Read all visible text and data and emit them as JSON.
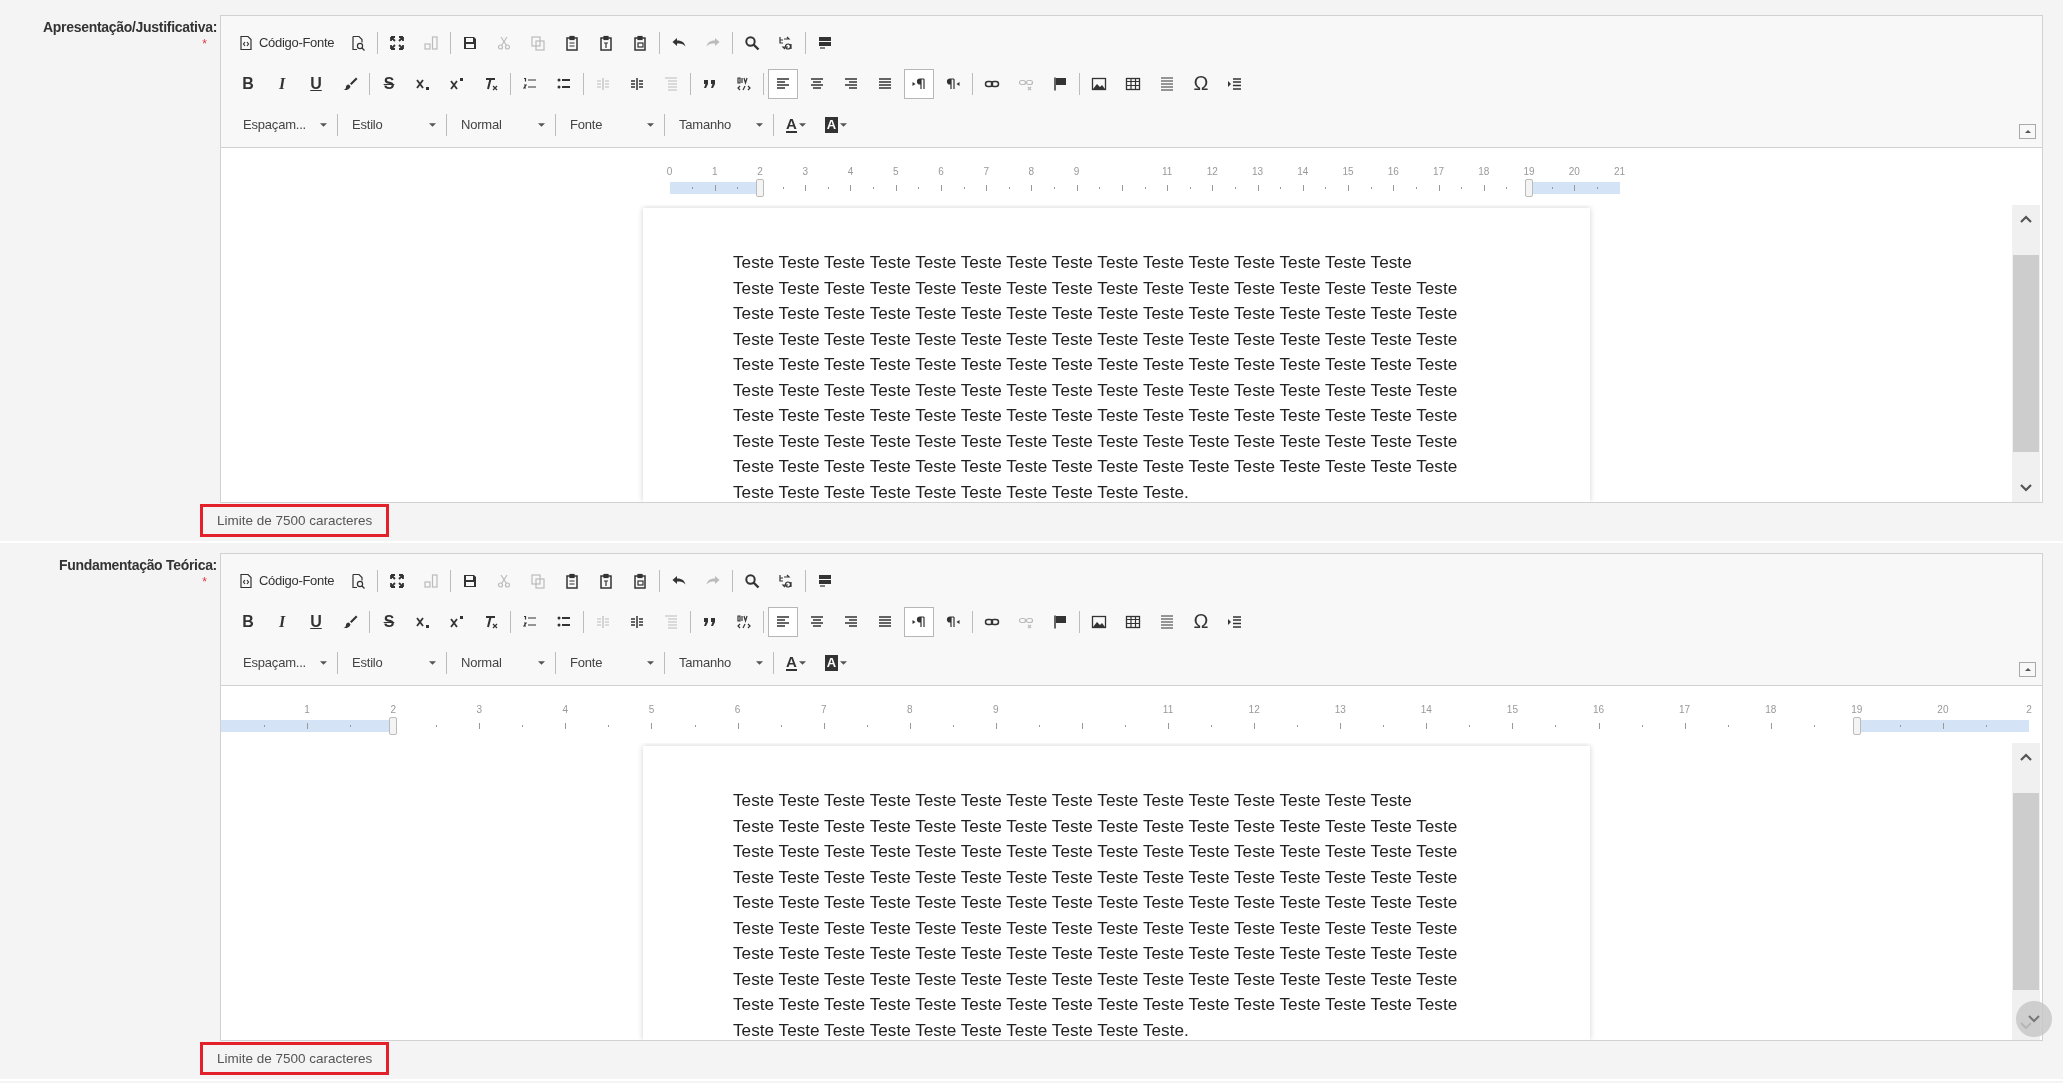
{
  "sections": [
    {
      "label": "Apresentação/Justificativa:",
      "required_mark": "*",
      "editor": {
        "toolbar": [
          [
            [
              {
                "kind": "label-button",
                "label": "Código-Fonte",
                "disabled": false,
                "selected": false
              },
              {
                "kind": "button",
                "disabled": false,
                "selected": false
              }
            ],
            [
              {
                "kind": "button",
                "disabled": false,
                "selected": false
              },
              {
                "kind": "button",
                "disabled": true,
                "selected": false
              }
            ],
            [
              {
                "kind": "button",
                "disabled": false,
                "selected": false
              },
              {
                "kind": "button",
                "disabled": true,
                "selected": false
              },
              {
                "kind": "button",
                "disabled": true,
                "selected": false
              },
              {
                "kind": "button",
                "disabled": false,
                "selected": false
              },
              {
                "kind": "button",
                "disabled": false,
                "selected": false
              },
              {
                "kind": "button",
                "disabled": false,
                "selected": false
              }
            ],
            [
              {
                "kind": "button",
                "disabled": false,
                "selected": false
              },
              {
                "kind": "button",
                "disabled": true,
                "selected": false
              }
            ],
            [
              {
                "kind": "button",
                "disabled": false,
                "selected": false
              },
              {
                "kind": "button",
                "disabled": false,
                "selected": false
              }
            ],
            [
              {
                "kind": "button",
                "disabled": false,
                "selected": false
              }
            ]
          ],
          [
            [
              {
                "kind": "glyph",
                "glyph": "B",
                "disabled": false,
                "selected": false
              },
              {
                "kind": "glyph",
                "glyph": "I",
                "disabled": false,
                "selected": false
              },
              {
                "kind": "glyph",
                "glyph": "U",
                "disabled": false,
                "selected": false
              },
              {
                "kind": "button",
                "disabled": false,
                "selected": false
              }
            ],
            [
              {
                "kind": "glyph",
                "glyph": "S",
                "disabled": false,
                "selected": false
              },
              {
                "kind": "button",
                "disabled": false,
                "selected": false
              },
              {
                "kind": "button",
                "disabled": false,
                "selected": false
              },
              {
                "kind": "button",
                "disabled": false,
                "selected": false
              }
            ],
            [
              {
                "kind": "button",
                "disabled": false,
                "selected": false
              },
              {
                "kind": "button",
                "disabled": false,
                "selected": false
              }
            ],
            [
              {
                "kind": "button",
                "disabled": true,
                "selected": false
              },
              {
                "kind": "button",
                "disabled": false,
                "selected": false
              },
              {
                "kind": "button",
                "disabled": true,
                "selected": false
              }
            ],
            [
              {
                "kind": "button",
                "disabled": false,
                "selected": false
              },
              {
                "kind": "button",
                "disabled": false,
                "selected": false
              }
            ],
            [
              {
                "kind": "button",
                "disabled": false,
                "selected": true
              },
              {
                "kind": "button",
                "disabled": false,
                "selected": false
              },
              {
                "kind": "button",
                "disabled": false,
                "selected": false
              },
              {
                "kind": "button",
                "disabled": false,
                "selected": false
              },
              {
                "kind": "button",
                "disabled": false,
                "selected": true
              },
              {
                "kind": "button",
                "disabled": false,
                "selected": false
              }
            ],
            [
              {
                "kind": "button",
                "disabled": false,
                "selected": false
              },
              {
                "kind": "button",
                "disabled": true,
                "selected": false
              },
              {
                "kind": "button",
                "disabled": false,
                "selected": false
              }
            ],
            [
              {
                "kind": "button",
                "disabled": false,
                "selected": false
              },
              {
                "kind": "button",
                "disabled": false,
                "selected": false
              },
              {
                "kind": "button",
                "disabled": false,
                "selected": false
              },
              {
                "kind": "glyph",
                "glyph": "Ω",
                "disabled": false,
                "selected": false
              },
              {
                "kind": "button",
                "disabled": false,
                "selected": false
              }
            ]
          ],
          [
            [
              {
                "kind": "dropdown",
                "label": "Espaçam..."
              }
            ],
            [
              {
                "kind": "dropdown",
                "label": "Estilo"
              }
            ],
            [
              {
                "kind": "dropdown",
                "label": "Normal"
              }
            ],
            [
              {
                "kind": "dropdown",
                "label": "Fonte"
              }
            ],
            [
              {
                "kind": "dropdown",
                "label": "Tamanho"
              }
            ],
            [
              {
                "kind": "color-menu",
                "glyph": "A"
              },
              {
                "kind": "color-menu-filled",
                "glyph": "A"
              }
            ]
          ]
        ],
        "ruler": {
          "kind": "fit",
          "ticks": [
            {
              "kind": "number",
              "label": "0"
            },
            {
              "kind": "number",
              "label": "1"
            },
            {
              "kind": "number",
              "label": "2"
            },
            {
              "kind": "number",
              "label": "3"
            },
            {
              "kind": "number",
              "label": "4"
            },
            {
              "kind": "number",
              "label": "5"
            },
            {
              "kind": "number",
              "label": "6"
            },
            {
              "kind": "number",
              "label": "7"
            },
            {
              "kind": "number",
              "label": "8"
            },
            {
              "kind": "number",
              "label": "9"
            },
            {
              "kind": "blank"
            },
            {
              "kind": "number",
              "label": "11"
            },
            {
              "kind": "number",
              "label": "12"
            },
            {
              "kind": "number",
              "label": "13"
            },
            {
              "kind": "number",
              "label": "14"
            },
            {
              "kind": "number",
              "label": "15"
            },
            {
              "kind": "number",
              "label": "16"
            },
            {
              "kind": "number",
              "label": "17"
            },
            {
              "kind": "number",
              "label": "18"
            },
            {
              "kind": "number",
              "label": "19"
            },
            {
              "kind": "number",
              "label": "20"
            },
            {
              "kind": "number",
              "label": "21"
            }
          ]
        },
        "lines": [
          "Teste Teste Teste Teste Teste Teste Teste Teste Teste Teste Teste Teste Teste Teste Teste",
          "Teste Teste Teste Teste Teste Teste Teste Teste Teste Teste Teste Teste Teste Teste Teste Teste",
          "Teste Teste Teste Teste Teste Teste Teste Teste Teste Teste Teste Teste Teste Teste Teste Teste",
          "Teste Teste Teste Teste Teste Teste Teste Teste Teste Teste Teste Teste Teste Teste Teste Teste",
          "Teste Teste Teste Teste Teste Teste Teste Teste Teste Teste Teste Teste Teste Teste Teste Teste",
          "Teste Teste Teste Teste Teste Teste Teste Teste Teste Teste Teste Teste Teste Teste Teste Teste",
          "Teste Teste Teste Teste Teste Teste Teste Teste Teste Teste Teste Teste Teste Teste Teste Teste",
          "Teste Teste Teste Teste Teste Teste Teste Teste Teste Teste Teste Teste Teste Teste Teste Teste",
          "Teste Teste Teste Teste Teste Teste Teste Teste Teste Teste Teste Teste Teste Teste Teste Teste",
          "Teste Teste Teste Teste Teste Teste Teste Teste Teste Teste."
        ]
      },
      "limit_note": "Limite de 7500 caracteres"
    },
    {
      "label": "Fundamentação Teórica:",
      "required_mark": "*",
      "editor": {
        "toolbar": [
          [
            [
              {
                "kind": "label-button",
                "label": "Código-Fonte",
                "disabled": false,
                "selected": false
              },
              {
                "kind": "button",
                "disabled": false,
                "selected": false
              }
            ],
            [
              {
                "kind": "button",
                "disabled": false,
                "selected": false
              },
              {
                "kind": "button",
                "disabled": true,
                "selected": false
              }
            ],
            [
              {
                "kind": "button",
                "disabled": false,
                "selected": false
              },
              {
                "kind": "button",
                "disabled": true,
                "selected": false
              },
              {
                "kind": "button",
                "disabled": true,
                "selected": false
              },
              {
                "kind": "button",
                "disabled": false,
                "selected": false
              },
              {
                "kind": "button",
                "disabled": false,
                "selected": false
              },
              {
                "kind": "button",
                "disabled": false,
                "selected": false
              }
            ],
            [
              {
                "kind": "button",
                "disabled": false,
                "selected": false
              },
              {
                "kind": "button",
                "disabled": true,
                "selected": false
              }
            ],
            [
              {
                "kind": "button",
                "disabled": false,
                "selected": false
              },
              {
                "kind": "button",
                "disabled": false,
                "selected": false
              }
            ],
            [
              {
                "kind": "button",
                "disabled": false,
                "selected": false
              }
            ]
          ],
          [
            [
              {
                "kind": "glyph",
                "glyph": "B",
                "disabled": false,
                "selected": false
              },
              {
                "kind": "glyph",
                "glyph": "I",
                "disabled": false,
                "selected": false
              },
              {
                "kind": "glyph",
                "glyph": "U",
                "disabled": false,
                "selected": false
              },
              {
                "kind": "button",
                "disabled": false,
                "selected": false
              }
            ],
            [
              {
                "kind": "glyph",
                "glyph": "S",
                "disabled": false,
                "selected": false
              },
              {
                "kind": "button",
                "disabled": false,
                "selected": false
              },
              {
                "kind": "button",
                "disabled": false,
                "selected": false
              },
              {
                "kind": "button",
                "disabled": false,
                "selected": false
              }
            ],
            [
              {
                "kind": "button",
                "disabled": false,
                "selected": false
              },
              {
                "kind": "button",
                "disabled": false,
                "selected": false
              }
            ],
            [
              {
                "kind": "button",
                "disabled": true,
                "selected": false
              },
              {
                "kind": "button",
                "disabled": false,
                "selected": false
              },
              {
                "kind": "button",
                "disabled": true,
                "selected": false
              }
            ],
            [
              {
                "kind": "button",
                "disabled": false,
                "selected": false
              },
              {
                "kind": "button",
                "disabled": false,
                "selected": false
              }
            ],
            [
              {
                "kind": "button",
                "disabled": false,
                "selected": true
              },
              {
                "kind": "button",
                "disabled": false,
                "selected": false
              },
              {
                "kind": "button",
                "disabled": false,
                "selected": false
              },
              {
                "kind": "button",
                "disabled": false,
                "selected": false
              },
              {
                "kind": "button",
                "disabled": false,
                "selected": true
              },
              {
                "kind": "button",
                "disabled": false,
                "selected": false
              }
            ],
            [
              {
                "kind": "button",
                "disabled": false,
                "selected": false
              },
              {
                "kind": "button",
                "disabled": true,
                "selected": false
              },
              {
                "kind": "button",
                "disabled": false,
                "selected": false
              }
            ],
            [
              {
                "kind": "button",
                "disabled": false,
                "selected": false
              },
              {
                "kind": "button",
                "disabled": false,
                "selected": false
              },
              {
                "kind": "button",
                "disabled": false,
                "selected": false
              },
              {
                "kind": "glyph",
                "glyph": "Ω",
                "disabled": false,
                "selected": false
              },
              {
                "kind": "button",
                "disabled": false,
                "selected": false
              }
            ]
          ],
          [
            [
              {
                "kind": "dropdown",
                "label": "Espaçam..."
              }
            ],
            [
              {
                "kind": "dropdown",
                "label": "Estilo"
              }
            ],
            [
              {
                "kind": "dropdown",
                "label": "Normal"
              }
            ],
            [
              {
                "kind": "dropdown",
                "label": "Fonte"
              }
            ],
            [
              {
                "kind": "dropdown",
                "label": "Tamanho"
              }
            ],
            [
              {
                "kind": "color-menu",
                "glyph": "A"
              },
              {
                "kind": "color-menu-filled",
                "glyph": "A"
              }
            ]
          ]
        ],
        "ruler": {
          "kind": "zoomed",
          "ticks": [
            {
              "kind": "blank"
            },
            {
              "kind": "number",
              "label": "1"
            },
            {
              "kind": "number",
              "label": "2"
            },
            {
              "kind": "number",
              "label": "3"
            },
            {
              "kind": "number",
              "label": "4"
            },
            {
              "kind": "number",
              "label": "5"
            },
            {
              "kind": "number",
              "label": "6"
            },
            {
              "kind": "number",
              "label": "7"
            },
            {
              "kind": "number",
              "label": "8"
            },
            {
              "kind": "number",
              "label": "9"
            },
            {
              "kind": "blank"
            },
            {
              "kind": "number",
              "label": "11"
            },
            {
              "kind": "number",
              "label": "12"
            },
            {
              "kind": "number",
              "label": "13"
            },
            {
              "kind": "number",
              "label": "14"
            },
            {
              "kind": "number",
              "label": "15"
            },
            {
              "kind": "number",
              "label": "16"
            },
            {
              "kind": "number",
              "label": "17"
            },
            {
              "kind": "number",
              "label": "18"
            },
            {
              "kind": "number",
              "label": "19"
            },
            {
              "kind": "number",
              "label": "20"
            },
            {
              "kind": "number",
              "label": "2"
            }
          ]
        },
        "lines": [
          "Teste Teste Teste Teste Teste Teste Teste Teste Teste Teste Teste Teste Teste Teste Teste",
          "Teste Teste Teste Teste Teste Teste Teste Teste Teste Teste Teste Teste Teste Teste Teste Teste",
          "Teste Teste Teste Teste Teste Teste Teste Teste Teste Teste Teste Teste Teste Teste Teste Teste",
          "Teste Teste Teste Teste Teste Teste Teste Teste Teste Teste Teste Teste Teste Teste Teste Teste",
          "Teste Teste Teste Teste Teste Teste Teste Teste Teste Teste Teste Teste Teste Teste Teste Teste",
          "Teste Teste Teste Teste Teste Teste Teste Teste Teste Teste Teste Teste Teste Teste Teste Teste",
          "Teste Teste Teste Teste Teste Teste Teste Teste Teste Teste Teste Teste Teste Teste Teste Teste",
          "Teste Teste Teste Teste Teste Teste Teste Teste Teste Teste Teste Teste Teste Teste Teste Teste",
          "Teste Teste Teste Teste Teste Teste Teste Teste Teste Teste Teste Teste Teste Teste Teste Teste",
          "Teste Teste Teste Teste Teste Teste Teste Teste Teste Teste."
        ]
      },
      "limit_note": "Limite de 7500 caracteres"
    }
  ]
}
